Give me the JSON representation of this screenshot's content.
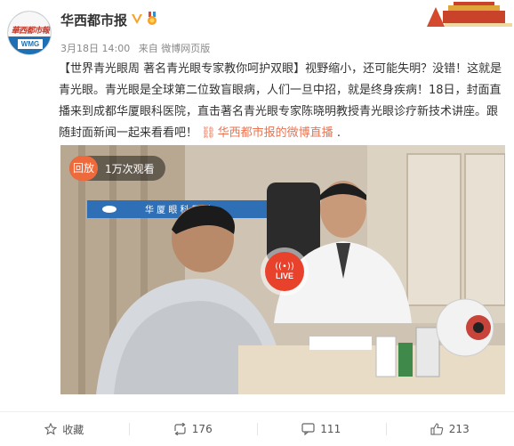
{
  "post": {
    "author": "华西都市报",
    "avatar_logo_text": "華西都市報",
    "avatar_badge": "WMG",
    "date": "3月18日 14:00",
    "source": "来自 微博网页版",
    "text_parts": {
      "topic": "【世界青光眼周 著名青光眼专家教你呵护双眼】",
      "body": "视野缩小，还可能失明？没错！这就是青光眼。青光眼是全球第二位致盲眼病，人们一旦中招，就是终身疾病！18日，封面直播来到成都华厦眼科医院，直击著名青光眼专家陈晓明教授青光眼诊疗新技术讲座。跟随封面新闻一起来看看吧！",
      "link": "华西都市报的微博直播",
      "trail": " ."
    }
  },
  "video": {
    "replay_label": "回放",
    "views": "1万次观看",
    "live_label": "LIVE",
    "wall_sign": "华 厦 眼 科 医 院"
  },
  "actions": {
    "favorite_label": "收藏",
    "repost_count": "176",
    "comment_count": "111",
    "like_count": "213"
  },
  "colors": {
    "accent": "#eb7350",
    "replay": "#ee6a3d",
    "live": "#e8412c",
    "verified": "#f7a227"
  }
}
